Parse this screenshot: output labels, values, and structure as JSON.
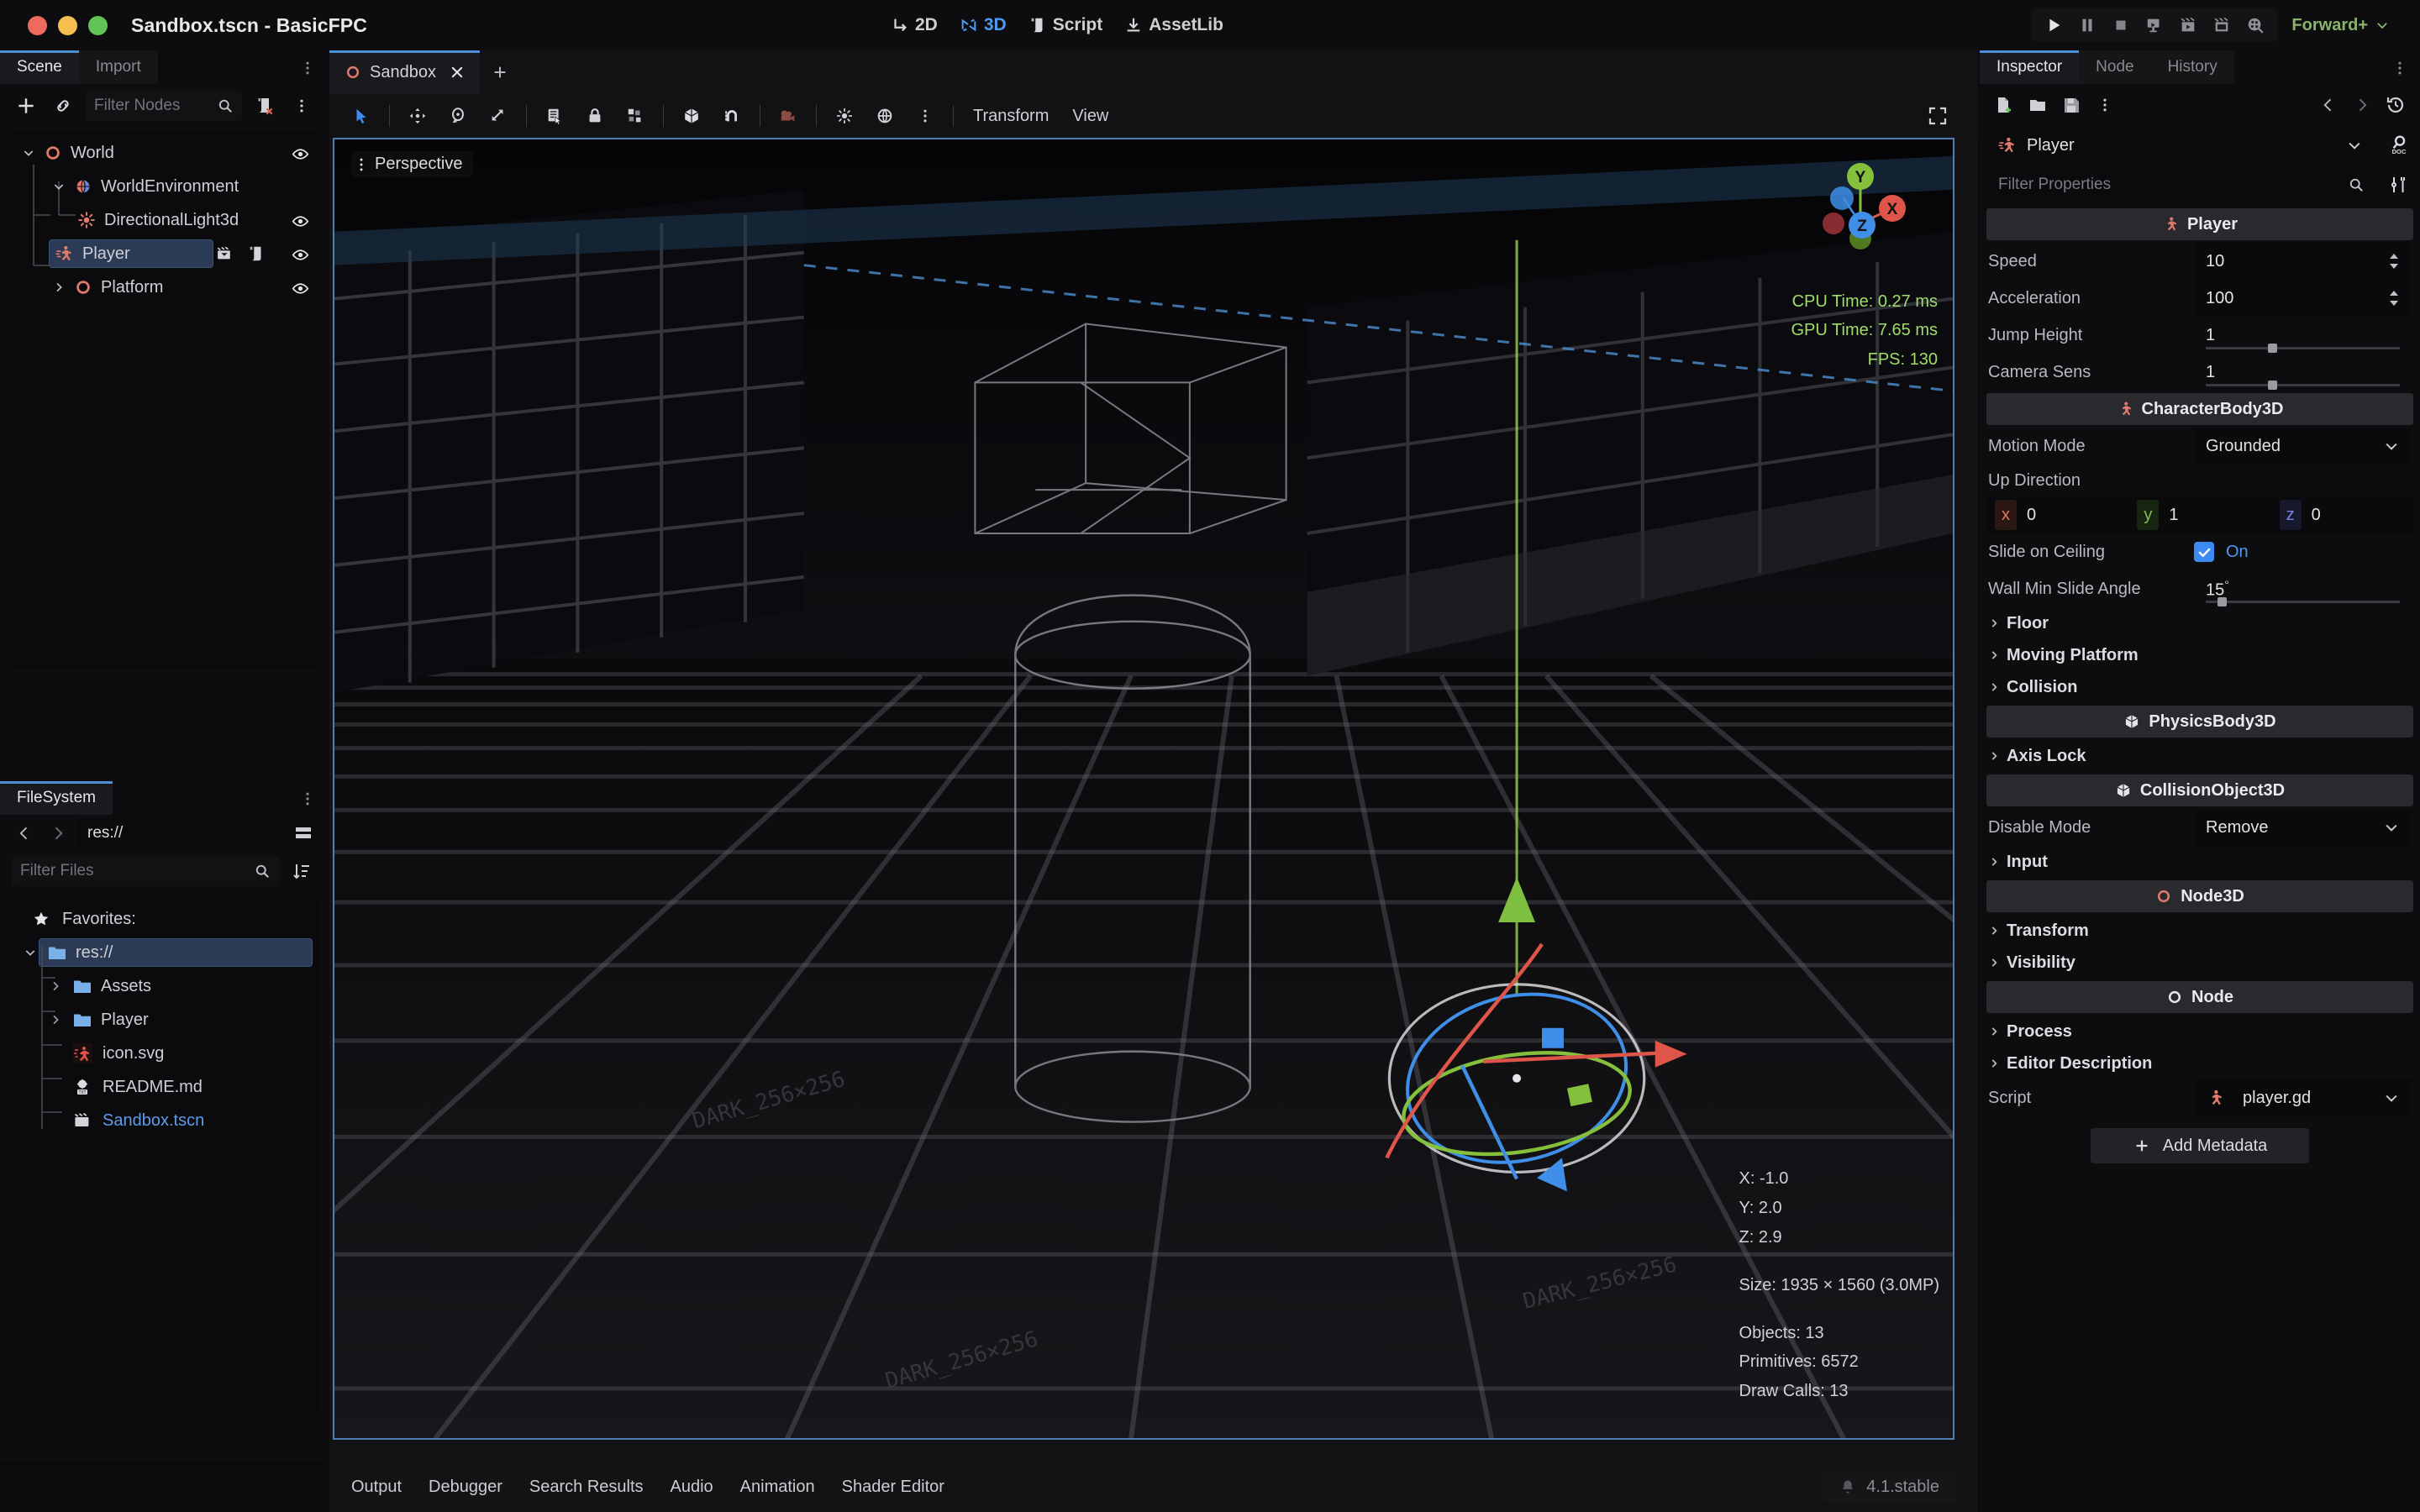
{
  "window": {
    "title": "Sandbox.tscn - BasicFPC",
    "traffic_lights": [
      "close",
      "minimize",
      "maximize"
    ]
  },
  "main_tabs": [
    {
      "label": "2D",
      "icon": "2d-icon",
      "active": false
    },
    {
      "label": "3D",
      "icon": "3d-icon",
      "active": true
    },
    {
      "label": "Script",
      "icon": "script-icon",
      "active": false
    },
    {
      "label": "AssetLib",
      "icon": "assetlib-icon",
      "active": false
    }
  ],
  "run_bar": {
    "buttons": [
      {
        "name": "play-button",
        "icon": "play-icon"
      },
      {
        "name": "pause-button",
        "icon": "pause-icon"
      },
      {
        "name": "stop-button",
        "icon": "stop-icon"
      },
      {
        "name": "run-current-scene-button",
        "icon": "monitor-icon"
      },
      {
        "name": "play-scene-button",
        "icon": "clapper-play-icon"
      },
      {
        "name": "play-custom-scene-button",
        "icon": "clapper-icon"
      },
      {
        "name": "movie-writer-button",
        "icon": "film-reel-icon"
      }
    ],
    "renderer": "Forward+"
  },
  "scene_dock": {
    "tabs": [
      {
        "label": "Scene",
        "active": true
      },
      {
        "label": "Import",
        "active": false
      }
    ],
    "toolbar": {
      "add_node_icon": "plus-icon",
      "instantiate_icon": "link-icon",
      "filter_placeholder": "Filter Nodes",
      "search_icon": "search-icon",
      "remote_icon": "script-remove-icon",
      "kebab_icon": "more-vertical-icon"
    },
    "nodes": [
      {
        "label": "World",
        "icon": "node3d-icon",
        "depth": 0,
        "expanded": true,
        "selected": false,
        "visibility": true
      },
      {
        "label": "WorldEnvironment",
        "icon": "world-environment-icon",
        "depth": 1,
        "expanded": true,
        "selected": false,
        "visibility": false
      },
      {
        "label": "DirectionalLight3d",
        "icon": "directional-light-icon",
        "depth": 2,
        "expanded": null,
        "selected": false,
        "visibility": true
      },
      {
        "label": "Player",
        "icon": "character-body-icon",
        "depth": 1,
        "expanded": null,
        "selected": true,
        "visibility": true,
        "has_scene_icon": true,
        "has_script_icon": true
      },
      {
        "label": "Platform",
        "icon": "node3d-icon",
        "depth": 1,
        "expanded": false,
        "selected": false,
        "visibility": true
      }
    ]
  },
  "filesystem_dock": {
    "tab": "FileSystem",
    "path": "res://",
    "back_icon": "chevron-left-icon",
    "forward_icon": "chevron-right-icon",
    "layout_icon": "split-view-icon",
    "filter_placeholder": "Filter Files",
    "search_icon": "search-icon",
    "sort_icon": "sort-icon",
    "items": [
      {
        "label": "Favorites:",
        "icon": "star-icon",
        "depth": 0,
        "kind": "header",
        "selected": false
      },
      {
        "label": "res://",
        "icon": "folder-icon",
        "depth": 0,
        "kind": "folder",
        "expanded": true,
        "selected": true
      },
      {
        "label": "Assets",
        "icon": "folder-icon",
        "depth": 1,
        "kind": "folder",
        "expanded": false,
        "selected": false
      },
      {
        "label": "Player",
        "icon": "folder-icon",
        "depth": 1,
        "kind": "folder",
        "expanded": false,
        "selected": false
      },
      {
        "label": "icon.svg",
        "icon": "svg-file-icon",
        "depth": 1,
        "kind": "file",
        "selected": false
      },
      {
        "label": "README.md",
        "icon": "text-file-icon",
        "depth": 1,
        "kind": "file",
        "selected": false
      },
      {
        "label": "Sandbox.tscn",
        "icon": "scene-file-icon",
        "depth": 1,
        "kind": "file",
        "selected": false,
        "highlight": true
      }
    ]
  },
  "scene_tabs": [
    {
      "label": "Sandbox",
      "icon": "node3d-icon",
      "active": true,
      "close_icon": "close-icon"
    }
  ],
  "add_tab_icon": "plus-icon",
  "viewport_toolbar": {
    "tools": [
      {
        "name": "select-mode-button",
        "icon": "cursor-icon",
        "active": true
      },
      {
        "sep": true
      },
      {
        "name": "move-mode-button",
        "icon": "move-icon"
      },
      {
        "name": "rotate-mode-button",
        "icon": "rotate-icon"
      },
      {
        "name": "scale-mode-button",
        "icon": "scale-icon"
      },
      {
        "sep": true
      },
      {
        "name": "list-select-button",
        "icon": "list-select-icon"
      },
      {
        "name": "lock-button",
        "icon": "lock-icon"
      },
      {
        "name": "group-button",
        "icon": "group-icon"
      },
      {
        "sep": true
      },
      {
        "name": "snap-mode-button",
        "icon": "cube-snap-icon"
      },
      {
        "name": "magnet-snap-button",
        "icon": "magnet-icon"
      },
      {
        "sep": true
      },
      {
        "name": "camera-preview-button",
        "icon": "camera-icon"
      },
      {
        "sep": true
      },
      {
        "name": "preview-sun-button",
        "icon": "sun-icon"
      },
      {
        "name": "preview-environment-button",
        "icon": "globe-icon"
      },
      {
        "name": "sun-env-options-button",
        "icon": "more-vertical-icon"
      }
    ],
    "menus": [
      "Transform",
      "View"
    ],
    "maximize_icon": "expand-icon"
  },
  "viewport": {
    "perspective_label": "Perspective",
    "perspective_menu_icon": "more-vertical-icon",
    "gizmo_axes": [
      "X",
      "Y",
      "Z"
    ],
    "performance": {
      "cpu_time": "CPU Time: 0.27 ms",
      "gpu_time": "GPU Time: 7.65 ms",
      "fps": "FPS: 130",
      "color": "#9fdd6a"
    },
    "info": {
      "x": "X: -1.0",
      "y": "Y: 2.0",
      "z": "Z: 2.9",
      "size": "Size: 1935 × 1560 (3.0MP)",
      "objects": "Objects: 13",
      "primitives": "Primitives: 6572",
      "draw_calls": "Draw Calls: 13"
    }
  },
  "bottom_panel": {
    "items": [
      "Output",
      "Debugger",
      "Search Results",
      "Audio",
      "Animation",
      "Shader Editor"
    ],
    "bell_icon": "bell-icon",
    "version": "4.1.stable"
  },
  "inspector": {
    "tabs": [
      {
        "label": "Inspector",
        "active": true
      },
      {
        "label": "Node",
        "active": false
      },
      {
        "label": "History",
        "active": false
      }
    ],
    "toolbar": {
      "new_resource_icon": "new-file-icon",
      "load_icon": "folder-open-icon",
      "save_icon": "save-icon",
      "kebab_icon": "more-vertical-icon",
      "back_icon": "chevron-left-icon",
      "forward_icon": "chevron-right-icon",
      "history_icon": "history-icon"
    },
    "object": {
      "name": "Player",
      "icon": "character-body-icon",
      "dropdown_icon": "chevron-down-icon",
      "doc_icon": "open-docs-icon"
    },
    "filter_placeholder": "Filter Properties",
    "search_icon": "search-icon",
    "settings_icon": "tools-icon",
    "sections": [
      {
        "type": "category",
        "label": "Player",
        "icon": "character-body-icon",
        "properties": [
          {
            "label": "Speed",
            "value": "10",
            "widget": "spin"
          },
          {
            "label": "Acceleration",
            "value": "100",
            "widget": "spin"
          },
          {
            "label": "Jump Height",
            "value": "1",
            "widget": "slider",
            "slider_pct": 32
          },
          {
            "label": "Camera Sens",
            "value": "1",
            "widget": "slider",
            "slider_pct": 32
          }
        ]
      },
      {
        "type": "category",
        "label": "CharacterBody3D",
        "icon": "character-body-icon",
        "properties": [
          {
            "label": "Motion Mode",
            "value": "Grounded",
            "widget": "enum"
          },
          {
            "label": "Up Direction",
            "widget": "label_only"
          },
          {
            "label": "",
            "widget": "vector3",
            "x": "0",
            "y": "1",
            "z": "0"
          },
          {
            "label": "Slide on Ceiling",
            "value": "On",
            "widget": "checkbox",
            "checked": true
          },
          {
            "label": "Wall Min Slide Angle",
            "value": "15",
            "unit": "°",
            "widget": "slider",
            "slider_pct": 6
          }
        ],
        "subgroups": [
          "Floor",
          "Moving Platform",
          "Collision"
        ]
      },
      {
        "type": "category",
        "label": "PhysicsBody3D",
        "icon": "cube-icon",
        "properties": [],
        "subgroups": [
          "Axis Lock"
        ]
      },
      {
        "type": "category",
        "label": "CollisionObject3D",
        "icon": "cube-icon",
        "properties": [
          {
            "label": "Disable Mode",
            "value": "Remove",
            "widget": "enum"
          }
        ],
        "subgroups": [
          "Input"
        ]
      },
      {
        "type": "category",
        "label": "Node3D",
        "icon": "node3d-icon",
        "properties": [],
        "subgroups": [
          "Transform",
          "Visibility"
        ]
      },
      {
        "type": "category",
        "label": "Node",
        "icon": "node-icon",
        "properties": [],
        "subgroups": [
          "Process",
          "Editor Description"
        ]
      }
    ],
    "script_row": {
      "label": "Script",
      "value": "player.gd",
      "icon": "character-body-icon",
      "dropdown_icon": "chevron-down-icon"
    },
    "add_metadata": {
      "label": "Add Metadata",
      "icon": "plus-icon"
    }
  },
  "colors": {
    "accent_blue": "#4d8fd6",
    "selection": "#2b3a55",
    "node_red": "#e07a6a",
    "folder_blue": "#7ab0e8",
    "perf_green": "#9fdd6a",
    "renderer_green": "#8ab46c",
    "link_blue": "#5d9cea"
  }
}
